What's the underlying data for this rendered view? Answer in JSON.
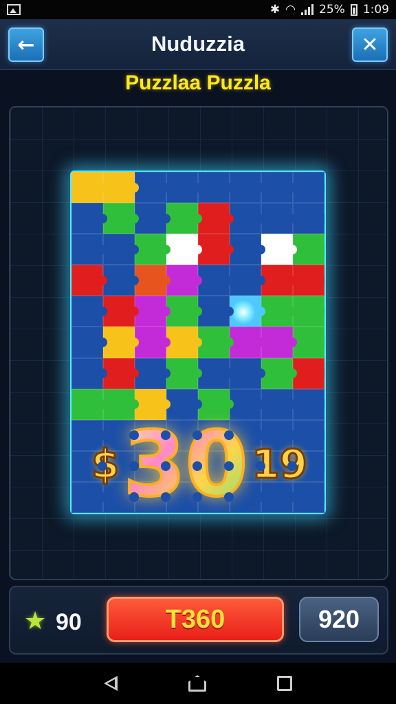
{
  "status_bar": {
    "battery": "25%",
    "time": "1:09"
  },
  "header": {
    "title": "Nuduzzia",
    "back_icon": "arrow-left-icon",
    "close_icon": "close-icon"
  },
  "subtitle": "Puzzlaa Puzzla",
  "board": {
    "score_left": "$",
    "score_main": "30",
    "score_right": "19",
    "piece_colors": [
      "#f7c21a",
      "#f7c21a",
      "#1b4fa8",
      "#1b4fa8",
      "#1b4fa8",
      "#1b4fa8",
      "#1b4fa8",
      "#1b4fa8",
      "#1b4fa8",
      "#2fbf3a",
      "#1b4fa8",
      "#2fbf3a",
      "#e01e1e",
      "#1b4fa8",
      "#1b4fa8",
      "#1b4fa8",
      "#1b4fa8",
      "#1b4fa8",
      "#2fbf3a",
      "#ffffff",
      "#e01e1e",
      "#1b4fa8",
      "#ffffff",
      "#2fbf3a",
      "#e01e1e",
      "#1b4fa8",
      "#e8541e",
      "#c42bd8",
      "#1b4fa8",
      "#1b4fa8",
      "#e01e1e",
      "#e01e1e",
      "#1b4fa8",
      "#e01e1e",
      "#c42bd8",
      "#2fbf3a",
      "#1b4fa8",
      "#4dc9ff",
      "#2fbf3a",
      "#2fbf3a",
      "#1b4fa8",
      "#f7c21a",
      "#c42bd8",
      "#f7c21a",
      "#2fbf3a",
      "#c42bd8",
      "#c42bd8",
      "#2fbf3a",
      "#1b4fa8",
      "#e01e1e",
      "#1b4fa8",
      "#2fbf3a",
      "#1b4fa8",
      "#1b4fa8",
      "#2fbf3a",
      "#e01e1e",
      "#2fbf3a",
      "#2fbf3a",
      "#f7c21a",
      "#1b4fa8",
      "#2fbf3a",
      "#1b4fa8",
      "#1b4fa8",
      "#1b4fa8",
      "#1b4fa8",
      "#1b4fa8",
      "#1b4fa8",
      "#1b4fa8",
      "#1b4fa8",
      "#1b4fa8",
      "#1b4fa8",
      "#1b4fa8",
      "#1b4fa8",
      "#1b4fa8",
      "#1b4fa8",
      "#1b4fa8",
      "#1b4fa8",
      "#1b4fa8",
      "#1b4fa8",
      "#1b4fa8",
      "#1b4fa8",
      "#1b4fa8",
      "#1b4fa8",
      "#1b4fa8",
      "#1b4fa8",
      "#1b4fa8",
      "#1b4fa8",
      "#1b4fa8"
    ]
  },
  "bottom_bar": {
    "star_icon": "star-icon",
    "coins": "90",
    "play_label": "T360",
    "secondary_label": "920"
  },
  "nav": {
    "back_icon": "nav-back-icon",
    "home_icon": "nav-home-icon",
    "recents_icon": "nav-recents-icon"
  }
}
